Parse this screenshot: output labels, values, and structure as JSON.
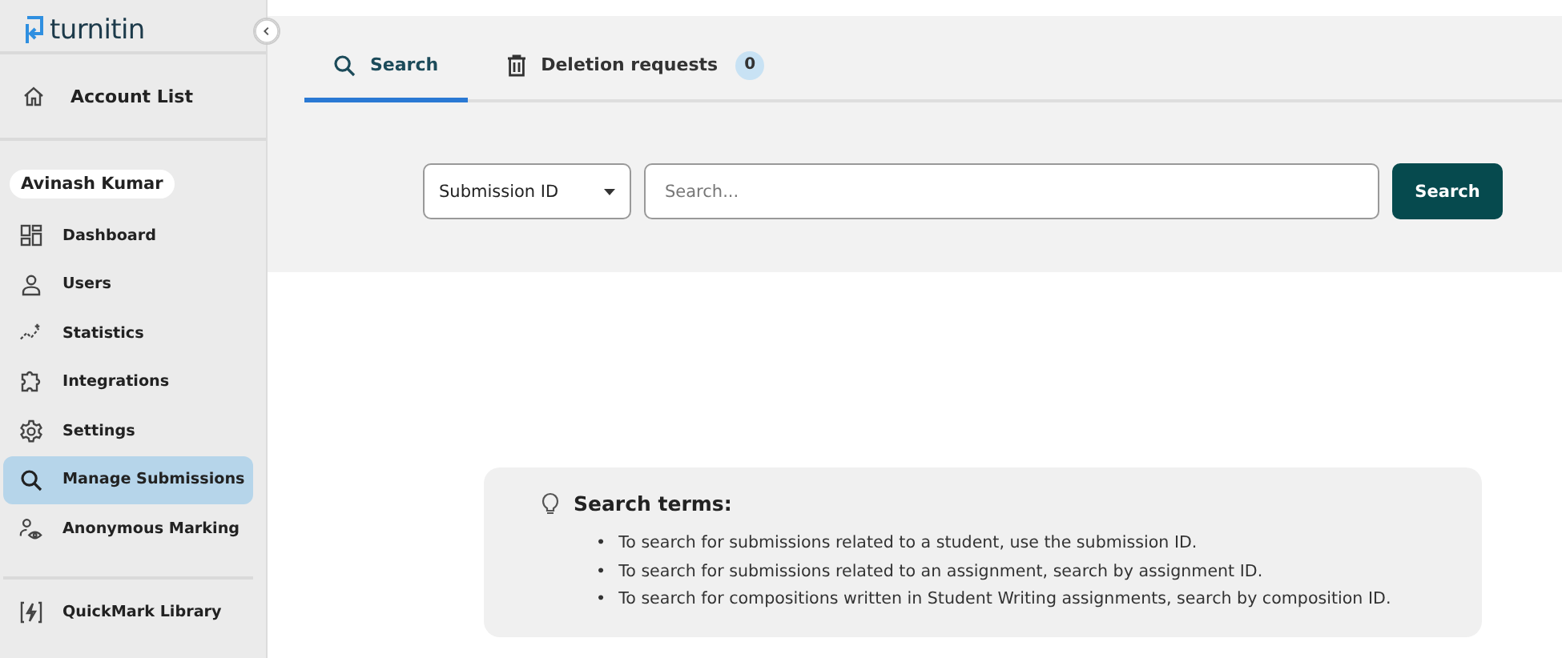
{
  "logo": {
    "text": "turnitin"
  },
  "sidebar": {
    "account_link": "Account List",
    "user_name": "Avinash Kumar",
    "items": [
      {
        "label": "Dashboard",
        "selected": false
      },
      {
        "label": "Users",
        "selected": false
      },
      {
        "label": "Statistics",
        "selected": false
      },
      {
        "label": "Integrations",
        "selected": false
      },
      {
        "label": "Settings",
        "selected": false
      },
      {
        "label": "Manage Submissions",
        "selected": true
      },
      {
        "label": "Anonymous Marking",
        "selected": false
      }
    ],
    "footer_items": [
      {
        "label": "QuickMark Library",
        "selected": false
      }
    ]
  },
  "tabs": [
    {
      "label": "Search",
      "selected": true
    },
    {
      "label": "Deletion requests",
      "selected": false,
      "badge": "0"
    }
  ],
  "search": {
    "filter": "Submission ID",
    "placeholder": "Search...",
    "button": "Search"
  },
  "hint": {
    "title": "Search terms:",
    "items": [
      {
        "bullet": "•",
        "text": "To search for submissions related to a student, use the submission ID."
      },
      {
        "bullet": "•",
        "text": "To search for submissions related to an assignment, search by assignment ID."
      },
      {
        "bullet": "•",
        "text": "To search for compositions written in Student Writing assignments, search by composition ID."
      }
    ]
  }
}
